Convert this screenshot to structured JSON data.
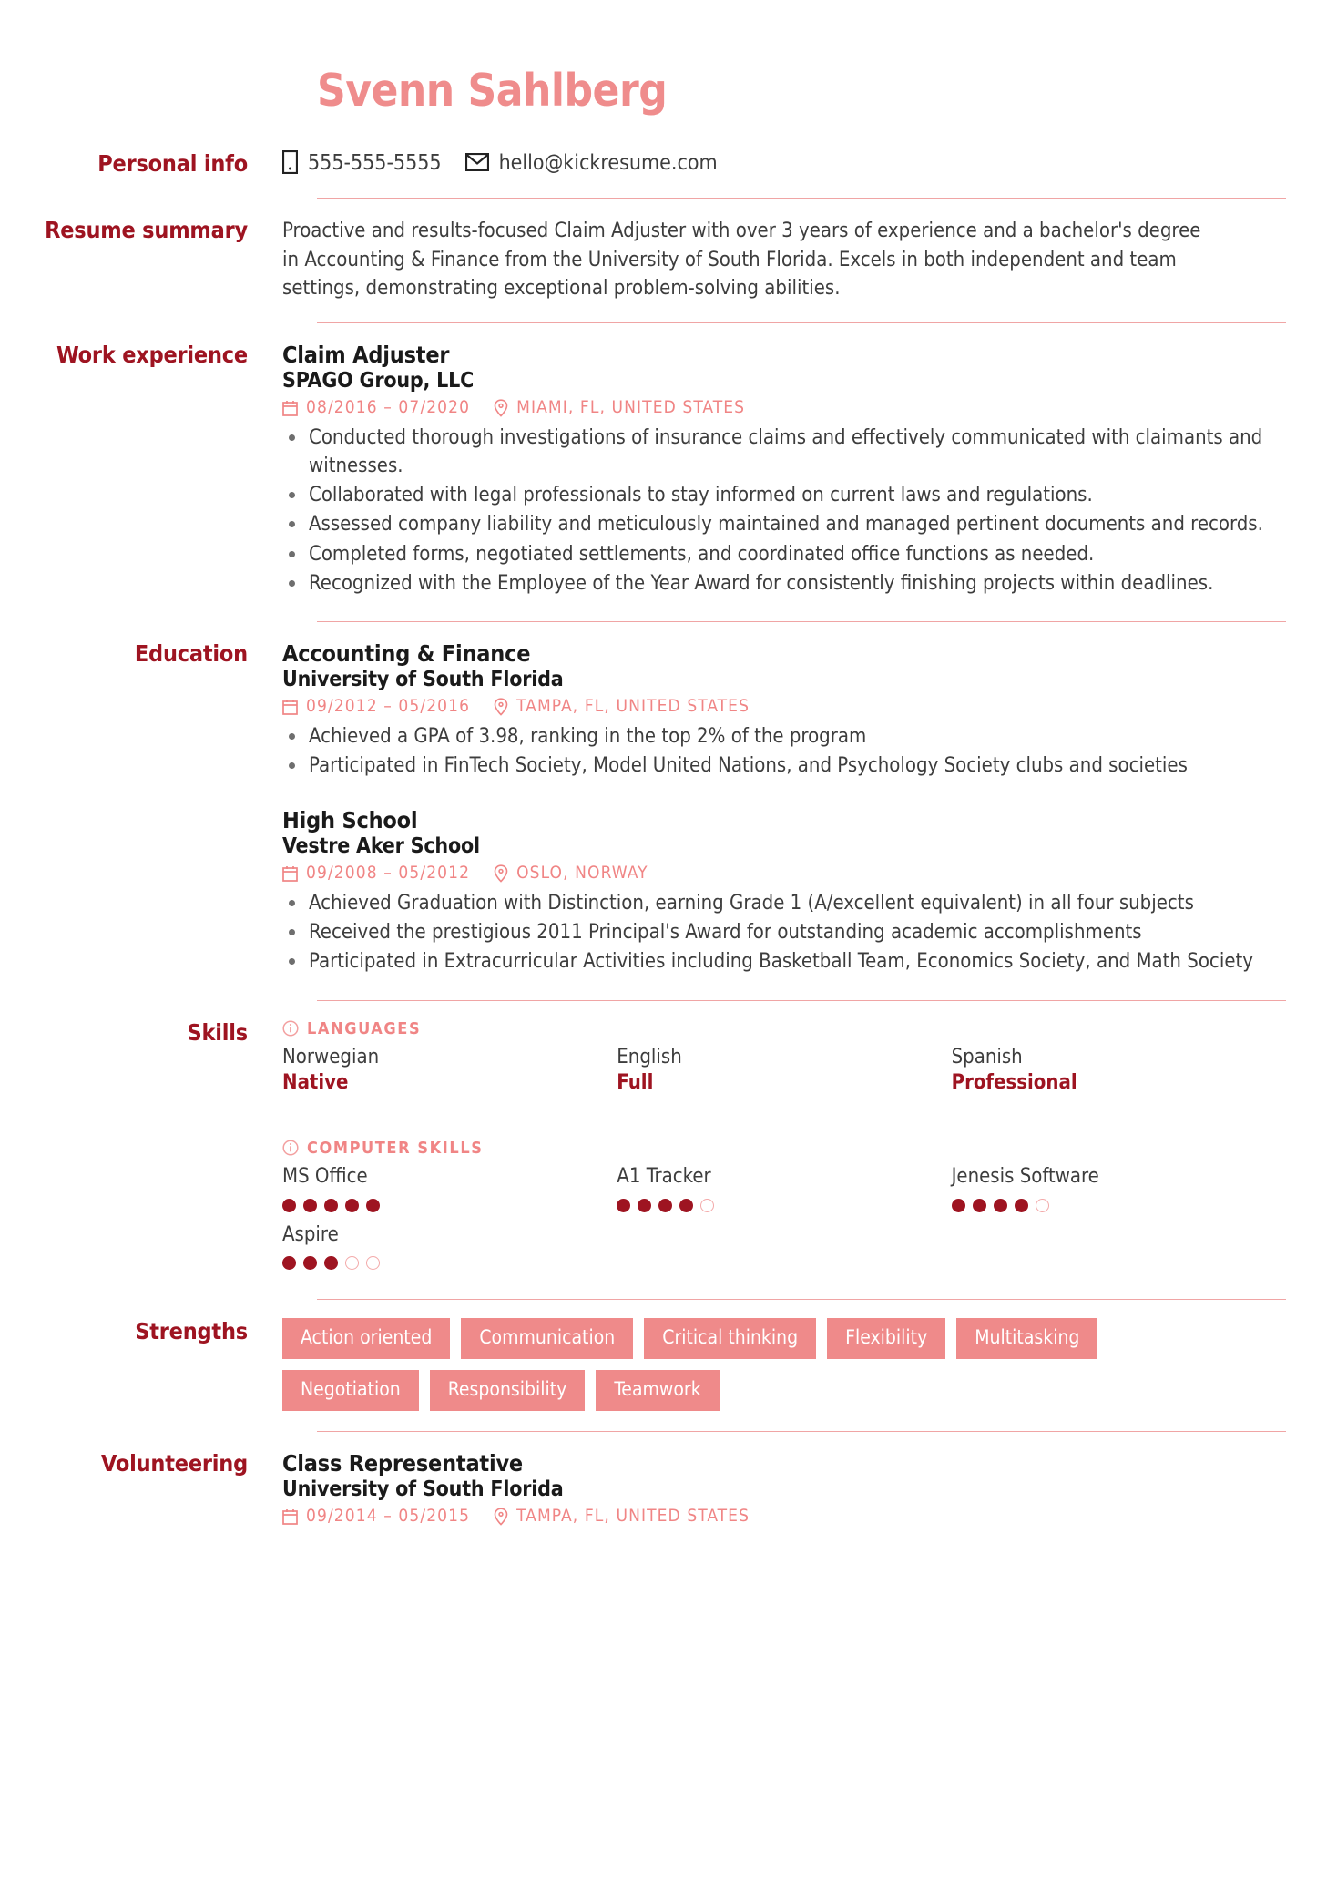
{
  "header": {
    "name": "Svenn Sahlberg",
    "accent": "#ef8c8c"
  },
  "sections": {
    "personal_info": "Personal info",
    "resume_summary": "Resume summary",
    "work_experience": "Work experience",
    "education": "Education",
    "skills": "Skills",
    "strengths": "Strengths",
    "volunteering": "Volunteering"
  },
  "contacts": [
    {
      "icon": "phone-icon",
      "value": "555-555-5555"
    },
    {
      "icon": "email-icon",
      "value": "hello@kickresume.com"
    }
  ],
  "summary": "Proactive and results-focused Claim Adjuster with over 3 years of experience and a bachelor's degree in Accounting & Finance from the University of South Florida. Excels in both independent and team settings, demonstrating exceptional problem-solving abilities.",
  "work": [
    {
      "title": "Claim Adjuster",
      "company": "SPAGO Group, LLC",
      "dates": "08/2016 – 07/2020",
      "location": "MIAMI, FL, UNITED STATES",
      "bullets": [
        "Conducted thorough investigations of insurance claims and effectively communicated with claimants and witnesses.",
        "Collaborated with legal professionals to stay informed on current laws and regulations.",
        "Assessed company liability and meticulously maintained and managed pertinent documents and records.",
        "Completed forms, negotiated settlements, and coordinated office functions as needed.",
        "Recognized with the Employee of the Year Award for consistently finishing projects within deadlines."
      ]
    }
  ],
  "education": [
    {
      "title": "Accounting & Finance",
      "company": "University of South Florida",
      "dates": "09/2012 – 05/2016",
      "location": "TAMPA, FL, UNITED STATES",
      "bullets": [
        "Achieved a GPA of 3.98, ranking in the top 2% of the program",
        "Participated in FinTech Society, Model United Nations, and Psychology Society clubs and societies"
      ]
    },
    {
      "title": "High School",
      "company": "Vestre Aker School",
      "dates": "09/2008 – 05/2012",
      "location": "OSLO, NORWAY",
      "bullets": [
        "Achieved Graduation with Distinction, earning Grade 1 (A/excellent equivalent) in all four subjects",
        "Received the prestigious 2011 Principal's Award for outstanding academic accomplishments",
        "Participated in Extracurricular Activities including Basketball Team, Economics Society, and Math Society"
      ]
    }
  ],
  "skills": {
    "languages_label": "LANGUAGES",
    "languages": [
      {
        "name": "Norwegian",
        "level": "Native"
      },
      {
        "name": "English",
        "level": "Full"
      },
      {
        "name": "Spanish",
        "level": "Professional"
      }
    ],
    "computer_label": "COMPUTER SKILLS",
    "computer": [
      {
        "name": "MS Office",
        "filled": 5,
        "total": 5
      },
      {
        "name": "A1 Tracker",
        "filled": 4,
        "total": 5
      },
      {
        "name": "Jenesis Software",
        "filled": 4,
        "total": 5
      },
      {
        "name": "Aspire",
        "filled": 3,
        "total": 5
      }
    ]
  },
  "strengths": [
    "Action oriented",
    "Communication",
    "Critical thinking",
    "Flexibility",
    "Multitasking",
    "Negotiation",
    "Responsibility",
    "Teamwork"
  ],
  "volunteering": [
    {
      "title": "Class Representative",
      "company": "University of South Florida",
      "dates": "09/2014 – 05/2015",
      "location": "TAMPA, FL, UNITED STATES"
    }
  ],
  "colors": {
    "label_red": "#9e1421",
    "salmon": "#ef8a8a",
    "text": "#3d3d3d",
    "dot_filled": "#9e1421"
  }
}
